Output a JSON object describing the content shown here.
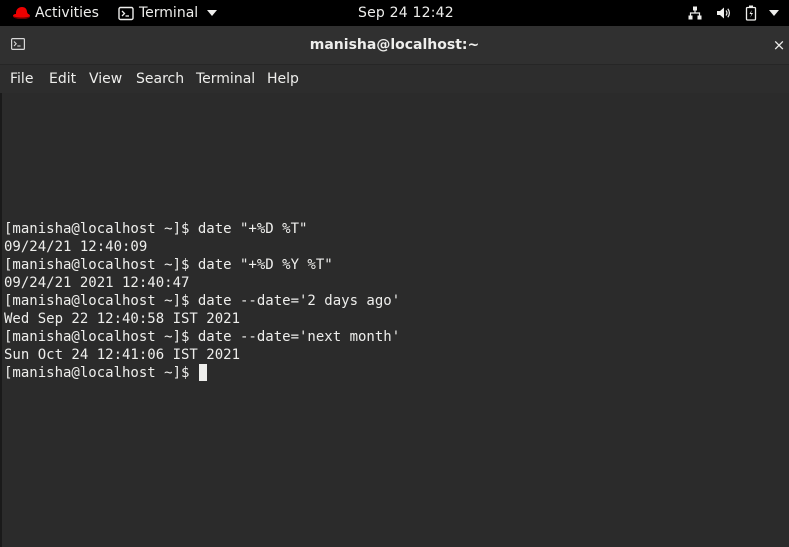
{
  "topbar": {
    "activities_label": "Activities",
    "app_menu_label": "Terminal",
    "clock": "Sep 24  12:42",
    "icons": [
      "network-icon",
      "volume-icon",
      "battery-icon",
      "chevron-down-icon"
    ]
  },
  "window": {
    "title": "manisha@localhost:~",
    "close_label": "×"
  },
  "menubar": {
    "items": [
      "File",
      "Edit",
      "View",
      "Search",
      "Terminal",
      "Help"
    ]
  },
  "terminal": {
    "lines": [
      "[manisha@localhost ~]$ date \"+%D %T\"",
      "09/24/21 12:40:09",
      "[manisha@localhost ~]$ date \"+%D %Y %T\"",
      "09/24/21 2021 12:40:47",
      "[manisha@localhost ~]$ date --date='2 days ago'",
      "Wed Sep 22 12:40:58 IST 2021",
      "[manisha@localhost ~]$ date --date='next month'",
      "Sun Oct 24 12:41:06 IST 2021"
    ],
    "prompt": "[manisha@localhost ~]$ "
  },
  "colors": {
    "topbar_bg": "#000000",
    "window_bg": "#2d2d2d",
    "terminal_bg": "#2b2b2b",
    "text": "#eeeeec",
    "redhat_red": "#ee0000"
  }
}
